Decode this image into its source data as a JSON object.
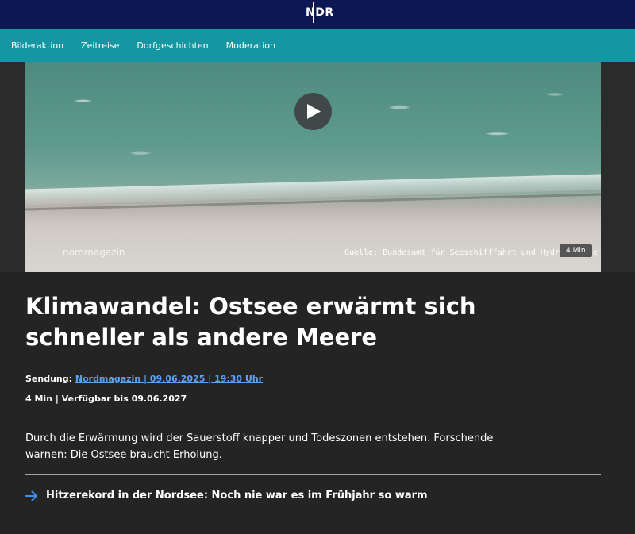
{
  "header": {
    "logo_text": "NDR"
  },
  "nav": {
    "items": [
      {
        "label": "Bilderaktion"
      },
      {
        "label": "Zeitreise"
      },
      {
        "label": "Dorfgeschichten"
      },
      {
        "label": "Moderation"
      }
    ]
  },
  "video": {
    "watermark": "nordmagazin",
    "source": "Quelle: Bundesamt für Seeschifffahrt und Hydrographie",
    "duration": "4 Min",
    "play_icon": "play-icon"
  },
  "article": {
    "title": "Klimawandel: Ostsee erwärmt sich schneller als andere Meere",
    "sendung_label": "Sendung:",
    "sendung_link": "Nordmagazin | 09.06.2025 | 19:30 Uhr",
    "availability": "4 Min | Verfügbar bis 09.06.2027",
    "description": "Durch die Erwärmung wird der Sauerstoff knapper und Todeszonen entstehen. Forschende warnen: Die Ostsee braucht Erholung.",
    "related_link": "Hitzerekord in der Nordsee: Noch nie war es im Frühjahr so warm"
  },
  "colors": {
    "topbar": "#0c1754",
    "nav": "#1597a3",
    "background": "#242424",
    "link": "#58a3f4",
    "arrow": "#3e8ef2"
  }
}
